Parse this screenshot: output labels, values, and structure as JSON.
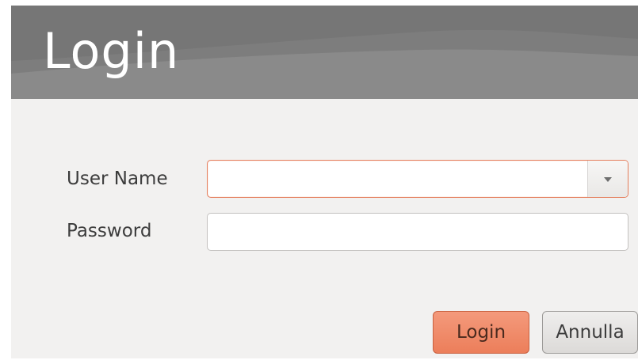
{
  "window": {
    "title": "Login"
  },
  "form": {
    "username": {
      "label": "User Name",
      "value": ""
    },
    "password": {
      "label": "Password",
      "value": ""
    }
  },
  "buttons": {
    "login_label": "Login",
    "cancel_label": "Annulla"
  },
  "icons": {
    "dropdown": "chevron-down-icon"
  },
  "colors": {
    "header": "#7f7f7f",
    "accent": "#ec7e5a",
    "background": "#f2f1f0"
  }
}
